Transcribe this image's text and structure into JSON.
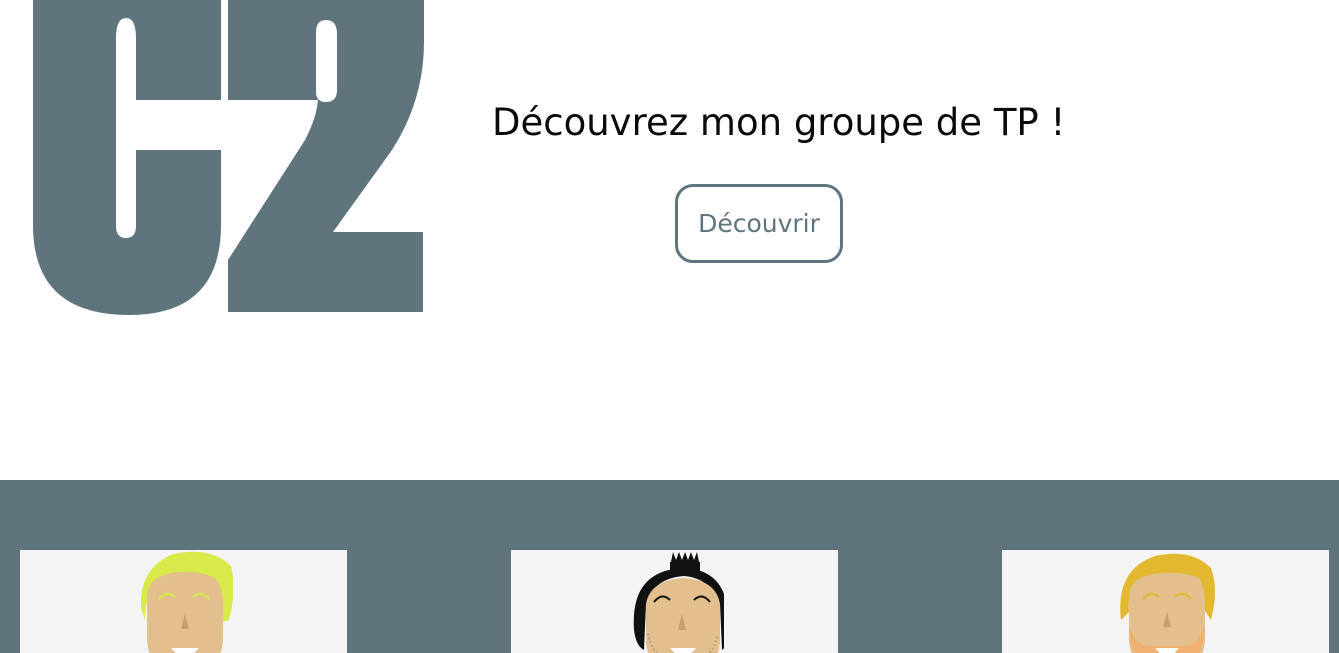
{
  "hero": {
    "logo_text": "C2",
    "tagline": "Découvrez mon groupe de TP !",
    "cta_label": "Découvrir"
  },
  "colors": {
    "brand_slate": "#5f747d",
    "card_background": "#f4f4f4",
    "skin": "#e2bf8c"
  },
  "members": [
    {
      "avatar_icon": "avatar-blond-hair-icon",
      "hair_color": "#d8ea4a"
    },
    {
      "avatar_icon": "avatar-black-topknot-icon",
      "hair_color": "#111111"
    },
    {
      "avatar_icon": "avatar-golden-hair-beard-icon",
      "hair_color": "#e2b92e"
    }
  ]
}
